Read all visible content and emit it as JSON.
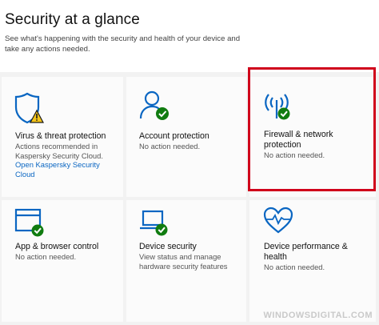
{
  "header": {
    "title": "Security at a glance",
    "subtitle": "See what's happening with the security and health of your device and take any actions needed."
  },
  "tiles": [
    {
      "icon": "shield-warning-icon",
      "title": "Virus & threat protection",
      "status": "Actions recommended in Kaspersky Security Cloud.",
      "link": "Open Kaspersky Security Cloud"
    },
    {
      "icon": "person-check-icon",
      "title": "Account protection",
      "status": "No action needed."
    },
    {
      "icon": "wifi-antenna-check-icon",
      "title": "Firewall & network protection",
      "status": "No action needed."
    },
    {
      "icon": "browser-window-check-icon",
      "title": "App & browser control",
      "status": "No action needed."
    },
    {
      "icon": "laptop-check-icon",
      "title": "Device security",
      "status": "View status and manage hardware security features"
    },
    {
      "icon": "heart-pulse-icon",
      "title": "Device performance & health",
      "status": "No action needed."
    }
  ],
  "watermark": "WINDOWSDIGITAL.COM",
  "colors": {
    "accent": "#0a66c2",
    "ok": "#107c10",
    "warning": "#f5c518",
    "highlight": "#d0021b"
  }
}
